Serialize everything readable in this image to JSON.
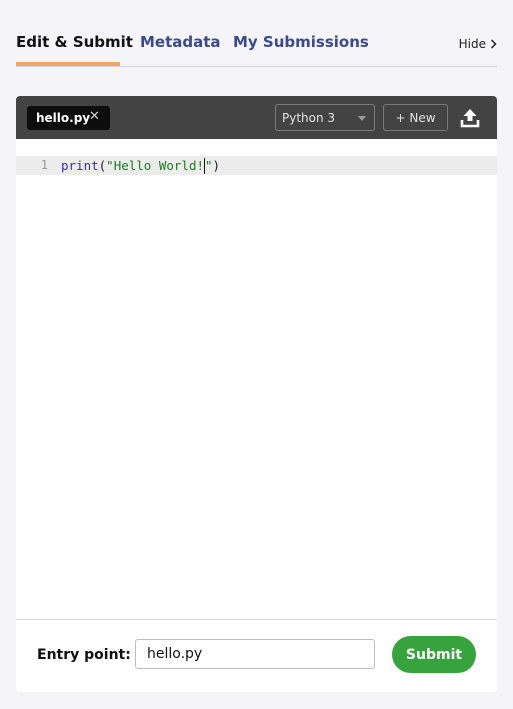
{
  "tabs": [
    {
      "label": "Edit & Submit",
      "active": true
    },
    {
      "label": "Metadata",
      "active": false
    },
    {
      "label": "My Submissions",
      "active": false
    }
  ],
  "hide_label": "Hide",
  "editor": {
    "file_tab": "hello.py",
    "language": "Python 3",
    "new_label": "+ New",
    "line_number": "1",
    "code": {
      "keyword": "print",
      "open_paren": "(",
      "string_before_cursor": "\"Hello World!",
      "string_after_cursor": "\"",
      "close_paren": ")"
    }
  },
  "footer": {
    "entry_label": "Entry point:",
    "entry_value": "hello.py",
    "submit_label": "Submit"
  },
  "colors": {
    "accent_underline": "#f0a464",
    "tab_link": "#3b4a8a",
    "toolbar": "#434343",
    "submit": "#36a33d"
  }
}
